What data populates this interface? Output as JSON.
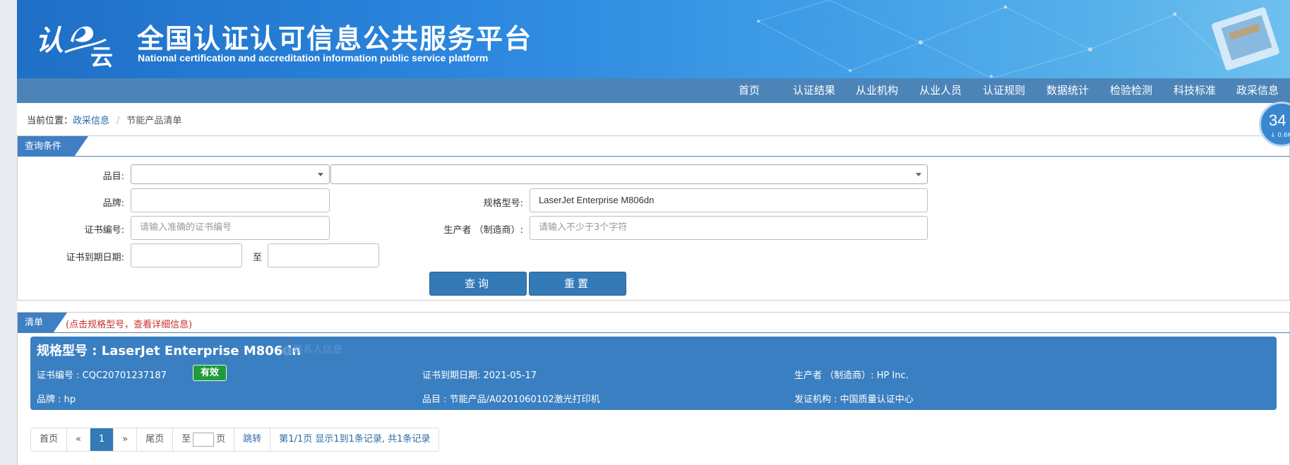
{
  "header": {
    "title": "全国认证认可信息公共服务平台",
    "subtitle": "National certification and accreditation information public service platform",
    "logo_text": "认e云"
  },
  "nav": {
    "items": [
      "首页",
      "认证结果",
      "从业机构",
      "从业人员",
      "认证规则",
      "数据统计",
      "检验检测",
      "科技标准",
      "政采信息"
    ]
  },
  "breadcrumb": {
    "prefix": "当前位置：",
    "parent": "政采信息",
    "current": "节能产品清单"
  },
  "query_panel": {
    "title": "查询条件",
    "labels": {
      "category": "品目:",
      "brand": "品牌:",
      "model": "规格型号:",
      "cert_no": "证书编号:",
      "manufacturer": "生产者 （制造商）:",
      "expiry": "证书到期日期:",
      "to": "至"
    },
    "values": {
      "model": "LaserJet Enterprise M806dn",
      "brand": "",
      "cert_no": "",
      "manufacturer": "",
      "date_from": "",
      "date_to": ""
    },
    "placeholders": {
      "cert_no": "请输入准确的证书编号",
      "manufacturer": "请输入不少于3个字符"
    },
    "buttons": {
      "search": "查询",
      "reset": "重置"
    }
  },
  "list_panel": {
    "title": "清单",
    "hint": "(点击规格型号，查看详细信息)"
  },
  "result": {
    "title": "规格型号 : LaserJet Enterprise M806dn",
    "contact": "联系人信息",
    "cert_no": "证书编号 : CQC20701237187",
    "status": "有效",
    "expiry": "证书到期日期: 2021-05-17",
    "manufacturer": "生产者 （制造商）: HP Inc.",
    "brand": "品牌 : hp",
    "category": "品目 : 节能产品/A0201060102激光打印机",
    "issuer": "发证机构 : 中国质量认证中心"
  },
  "pagination": {
    "first": "首页",
    "prev": "«",
    "page": "1",
    "next": "»",
    "last": "尾页",
    "goto_prefix": "至",
    "goto_suffix": "页",
    "jump": "跳转",
    "summary": "第1/1页  显示1到1条记录, 共1条记录"
  },
  "speed_widget": {
    "value": "34",
    "sub": "↓ 0.6K"
  },
  "colors": {
    "nav": "#4d84b8",
    "accent": "#337ab7",
    "card": "#3a7fc1",
    "valid_badge": "#1f9c3a",
    "hint_red": "#c9302c"
  }
}
